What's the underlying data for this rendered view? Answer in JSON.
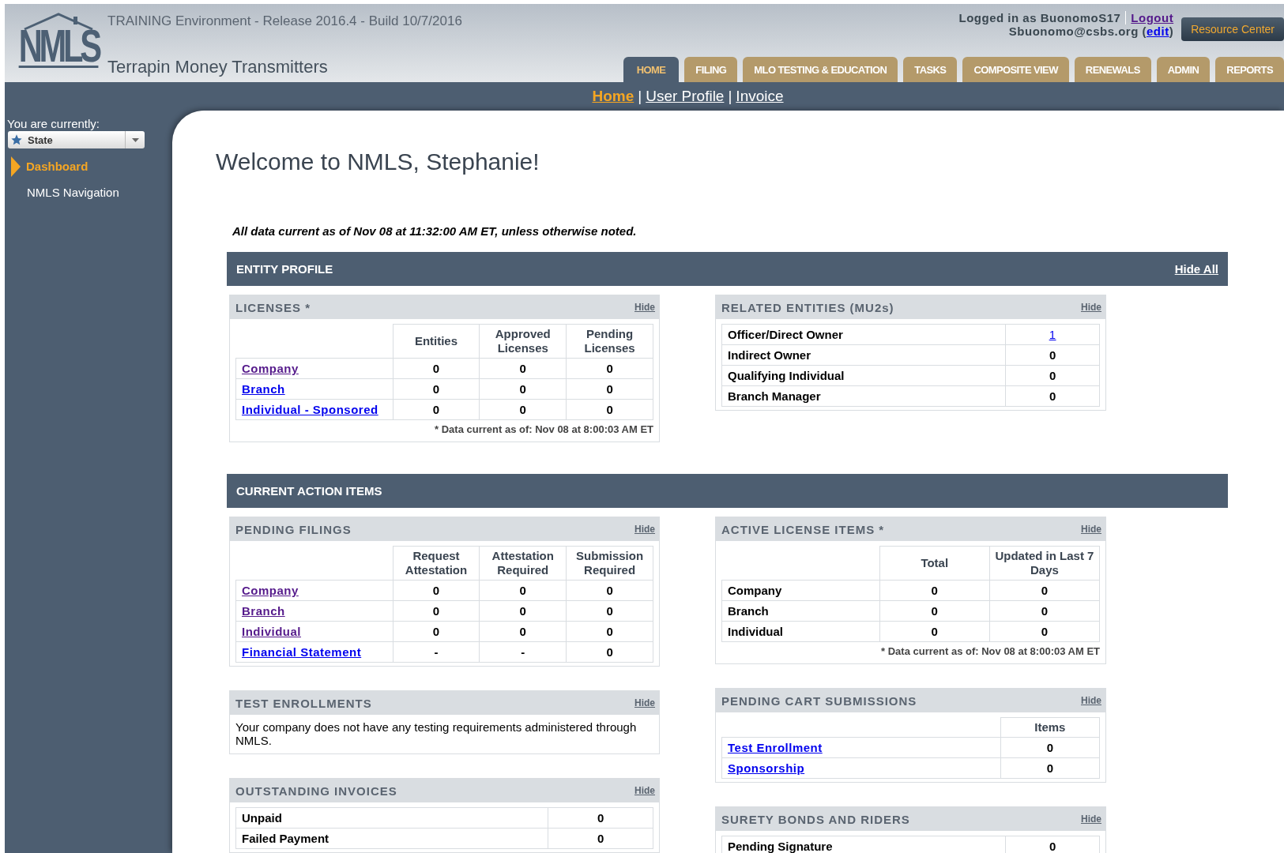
{
  "header": {
    "logo": "NMLS",
    "environment": "TRAINING Environment - Release 2016.4 - Build 10/7/2016",
    "company": "Terrapin Money Transmitters",
    "login_text": "Logged in as BuonomoS17",
    "logout": "Logout",
    "email_prefix": "Sbuonomo@csbs.org (",
    "edit_link": "edit",
    "email_suffix": ")",
    "resource_center": "Resource Center"
  },
  "tabs": [
    {
      "label": "HOME",
      "selected": true
    },
    {
      "label": "FILING",
      "selected": false
    },
    {
      "label": "MLO TESTING & EDUCATION",
      "selected": false
    },
    {
      "label": "TASKS",
      "selected": false
    },
    {
      "label": "COMPOSITE VIEW",
      "selected": false
    },
    {
      "label": "RENEWALS",
      "selected": false
    },
    {
      "label": "ADMIN",
      "selected": false
    },
    {
      "label": "REPORTS",
      "selected": false
    }
  ],
  "subnav": {
    "separator": "|",
    "links": [
      {
        "label": "Home",
        "selected": true
      },
      {
        "label": "User Profile",
        "selected": false
      },
      {
        "label": "Invoice",
        "selected": false
      }
    ]
  },
  "sidebar": {
    "context_label": "You are currently:",
    "context_value": "State",
    "items": [
      {
        "label": "Dashboard",
        "selected": true
      },
      {
        "label": "NMLS Navigation",
        "selected": false
      }
    ]
  },
  "welcome": "Welcome to NMLS, Stephanie!",
  "data_note": "All data current as of Nov 08 at 11:32:00 AM ET, unless otherwise noted.",
  "sections": [
    {
      "title": "ENTITY PROFILE",
      "action": "Hide All",
      "left_panels": [
        {
          "title": "LICENSES *",
          "hide": "Hide",
          "columns": [
            "Entities",
            "Approved Licenses",
            "Pending Licenses"
          ],
          "rows": [
            {
              "label": "Company",
              "kind": "link",
              "visited": true,
              "values": [
                "0",
                "0",
                "0"
              ]
            },
            {
              "label": "Branch",
              "kind": "link",
              "visited": false,
              "values": [
                "0",
                "0",
                "0"
              ]
            },
            {
              "label": "Individual - Sponsored",
              "kind": "link",
              "visited": false,
              "values": [
                "0",
                "0",
                "0"
              ]
            }
          ],
          "note": "* Data current as of: Nov 08 at 8:00:03 AM ET"
        }
      ],
      "right_panels": [
        {
          "title": "RELATED ENTITIES (MU2s)",
          "hide": "Hide",
          "rows": [
            {
              "label": "Officer/Direct Owner",
              "kind": "text",
              "values": [
                {
                  "text": "1",
                  "kind": "link"
                }
              ]
            },
            {
              "label": "Indirect Owner",
              "kind": "text",
              "values": [
                "0"
              ]
            },
            {
              "label": "Qualifying Individual",
              "kind": "text",
              "values": [
                "0"
              ]
            },
            {
              "label": "Branch Manager",
              "kind": "text",
              "values": [
                "0"
              ]
            }
          ]
        }
      ]
    },
    {
      "title": "CURRENT ACTION ITEMS",
      "left_panels": [
        {
          "title": "PENDING FILINGS",
          "hide": "Hide",
          "columns": [
            "Request Attestation",
            "Attestation Required",
            "Submission Required"
          ],
          "rows": [
            {
              "label": "Company",
              "kind": "link",
              "visited": true,
              "values": [
                "0",
                "0",
                "0"
              ]
            },
            {
              "label": "Branch",
              "kind": "link",
              "visited": true,
              "values": [
                "0",
                "0",
                "0"
              ]
            },
            {
              "label": "Individual",
              "kind": "link",
              "visited": true,
              "values": [
                "0",
                "0",
                "0"
              ]
            },
            {
              "label": "Financial Statement",
              "kind": "link",
              "visited": false,
              "values": [
                "-",
                "-",
                "0"
              ]
            }
          ]
        },
        {
          "title": "TEST ENROLLMENTS",
          "hide": "Hide",
          "text": "Your company does not have any testing requirements administered through NMLS."
        },
        {
          "title": "OUTSTANDING INVOICES",
          "hide": "Hide",
          "rows": [
            {
              "label": "Unpaid",
              "kind": "text",
              "values": [
                "0"
              ]
            },
            {
              "label": "Failed Payment",
              "kind": "text",
              "values": [
                "0"
              ]
            }
          ]
        }
      ],
      "right_panels": [
        {
          "title": "ACTIVE LICENSE ITEMS *",
          "hide": "Hide",
          "columns": [
            "Total",
            "Updated in Last 7 Days"
          ],
          "rows": [
            {
              "label": "Company",
              "kind": "text",
              "values": [
                "0",
                "0"
              ]
            },
            {
              "label": "Branch",
              "kind": "text",
              "values": [
                "0",
                "0"
              ]
            },
            {
              "label": "Individual",
              "kind": "text",
              "values": [
                "0",
                "0"
              ]
            }
          ],
          "note": "* Data current as of: Nov 08 at 8:00:03 AM ET"
        },
        {
          "title": "PENDING CART SUBMISSIONS",
          "hide": "Hide",
          "columns": [
            "Items"
          ],
          "rows": [
            {
              "label": "Test Enrollment",
              "kind": "link",
              "visited": false,
              "values": [
                "0"
              ]
            },
            {
              "label": "Sponsorship",
              "kind": "link",
              "visited": false,
              "values": [
                "0"
              ]
            }
          ]
        },
        {
          "title": "SURETY BONDS AND RIDERS",
          "hide": "Hide",
          "rows": [
            {
              "label": "Pending Signature",
              "kind": "text",
              "values": [
                "0"
              ]
            }
          ]
        }
      ]
    }
  ]
}
